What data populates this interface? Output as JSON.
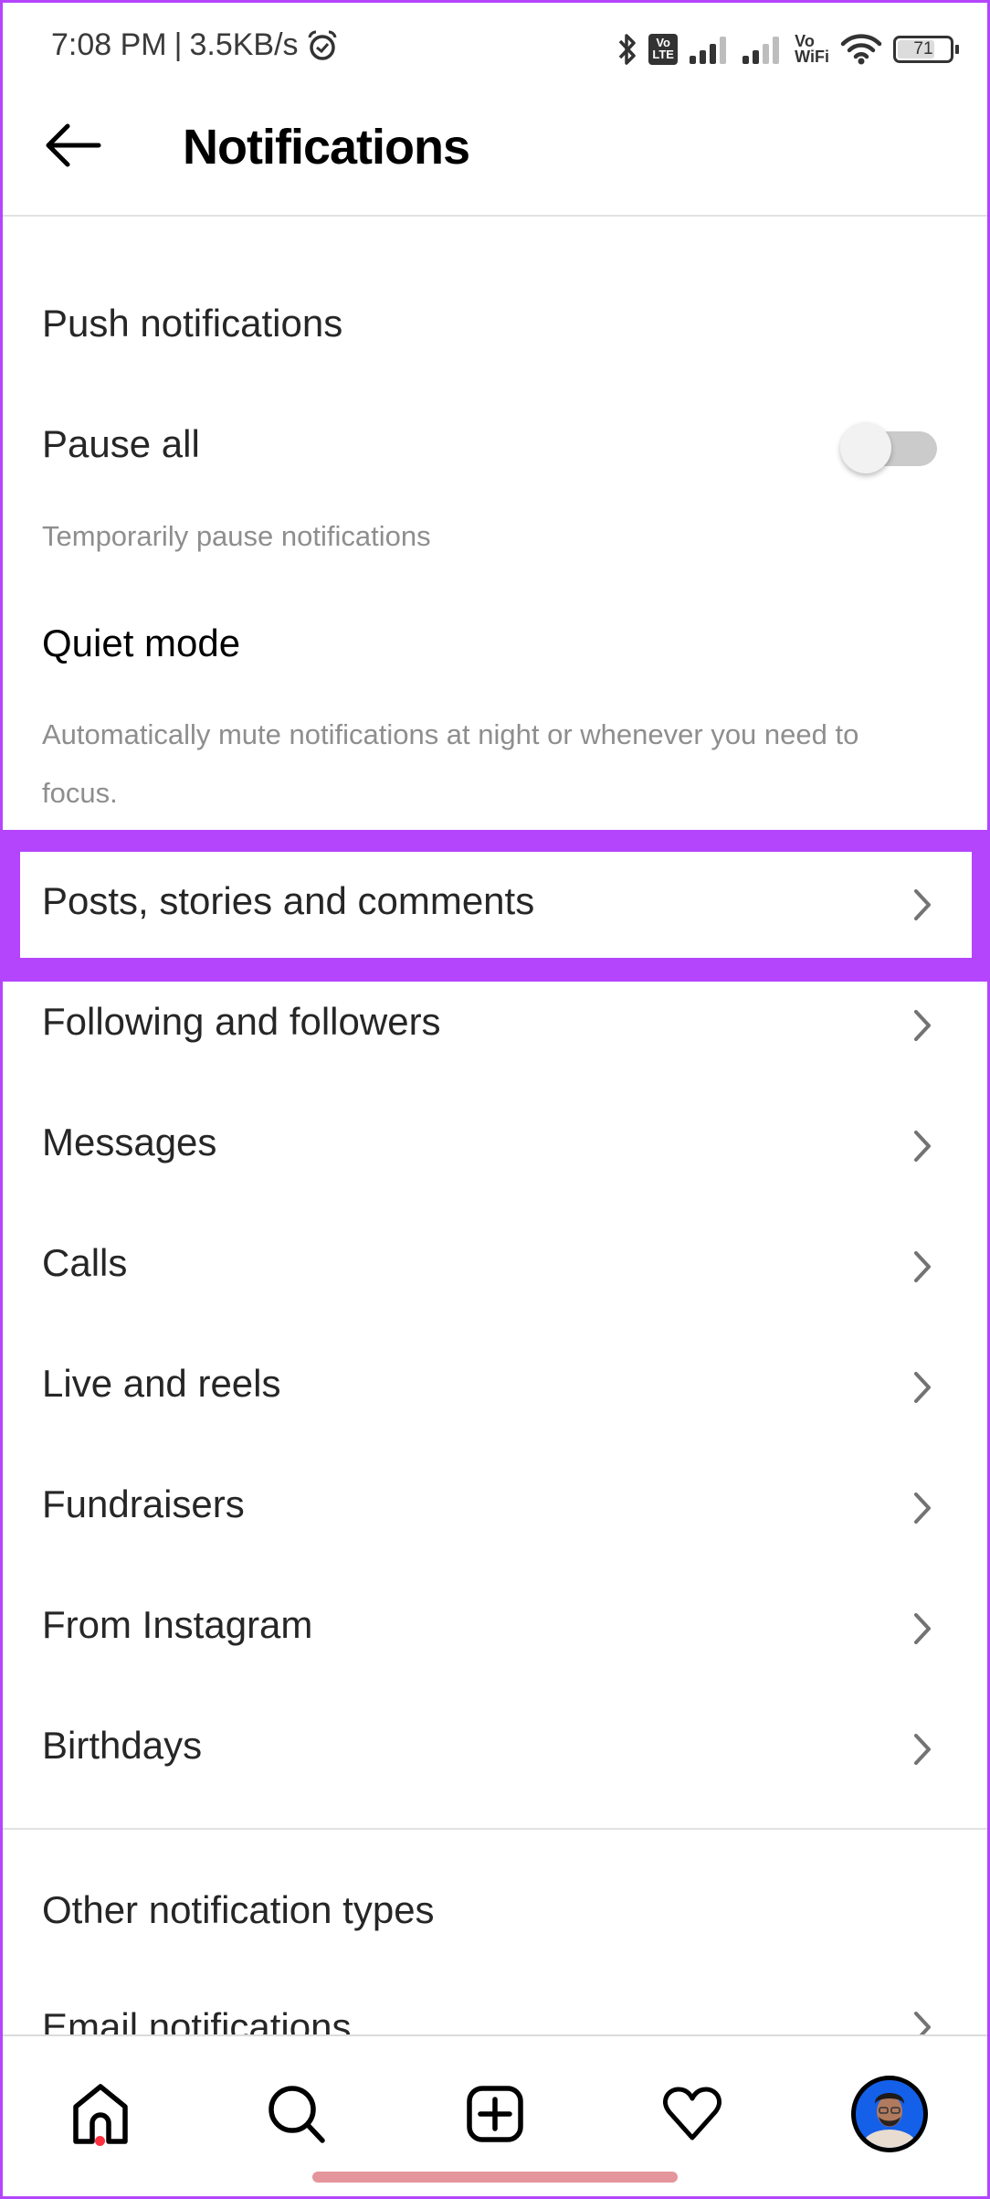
{
  "status_bar": {
    "time": "7:08 PM",
    "separator": "|",
    "network_speed": "3.5KB/s",
    "icons": [
      "alarm-icon",
      "bluetooth-icon",
      "volte-icon",
      "signal-icon",
      "signal-icon",
      "vowifi-icon",
      "wifi-icon",
      "battery-icon"
    ],
    "volte_line1": "Vo",
    "volte_line2": "LTE",
    "vowifi_line1": "Vo",
    "vowifi_line2": "WiFi",
    "battery_level": "71"
  },
  "header": {
    "back_icon": "arrow-left-icon",
    "title": "Notifications"
  },
  "push": {
    "section_title": "Push notifications",
    "pause_all": {
      "label": "Pause all",
      "toggle_on": false,
      "description": "Temporarily pause notifications"
    },
    "quiet_mode": {
      "label": "Quiet mode",
      "description": "Automatically mute notifications at night or whenever you need to focus."
    }
  },
  "categories": [
    {
      "label": "Posts, stories and comments",
      "highlighted": true
    },
    {
      "label": "Following and followers"
    },
    {
      "label": "Messages"
    },
    {
      "label": "Calls"
    },
    {
      "label": "Live and reels"
    },
    {
      "label": "Fundraisers"
    },
    {
      "label": "From Instagram"
    },
    {
      "label": "Birthdays"
    }
  ],
  "other": {
    "section_title": "Other notification types",
    "items": [
      {
        "label": "Email notifications"
      }
    ]
  },
  "bottom_nav": {
    "items": [
      "home-icon",
      "search-icon",
      "create-post-icon",
      "activity-heart-icon",
      "profile-avatar"
    ],
    "home_has_badge": true
  },
  "colors": {
    "highlight": "#b445fd",
    "badge": "#ff3040",
    "avatar_bg": "#1560e8"
  }
}
